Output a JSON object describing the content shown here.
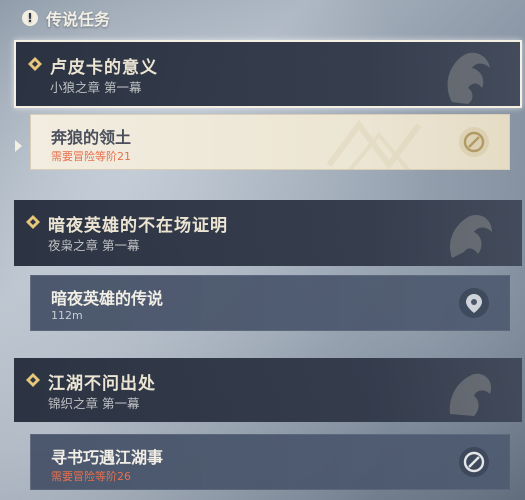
{
  "panel": {
    "title": "传说任务",
    "alert_icon": "exclamation-icon"
  },
  "quests": [
    {
      "title": "卢皮卡的意义",
      "chapter": "小狼之章 第一幕",
      "selected": true,
      "item": {
        "name": "奔狼的领土",
        "detail": "需要冒险等阶21",
        "status": "locked-icon",
        "active": true
      }
    },
    {
      "title": "暗夜英雄的不在场证明",
      "chapter": "夜枭之章 第一幕",
      "selected": false,
      "item": {
        "name": "暗夜英雄的传说",
        "detail": "112m",
        "status": "location-pin-icon",
        "active": false
      }
    },
    {
      "title": "江湖不问出处",
      "chapter": "锦织之章 第一幕",
      "selected": false,
      "item": {
        "name": "寻书巧遇江湖事",
        "detail": "需要冒险等阶26",
        "status": "locked-icon",
        "active": false
      }
    }
  ],
  "colors": {
    "accent_gold": "#e8c77a",
    "warning_text": "#e76f4e",
    "header_bg": "#2e3646",
    "active_item_bg": "#f2ede0"
  }
}
